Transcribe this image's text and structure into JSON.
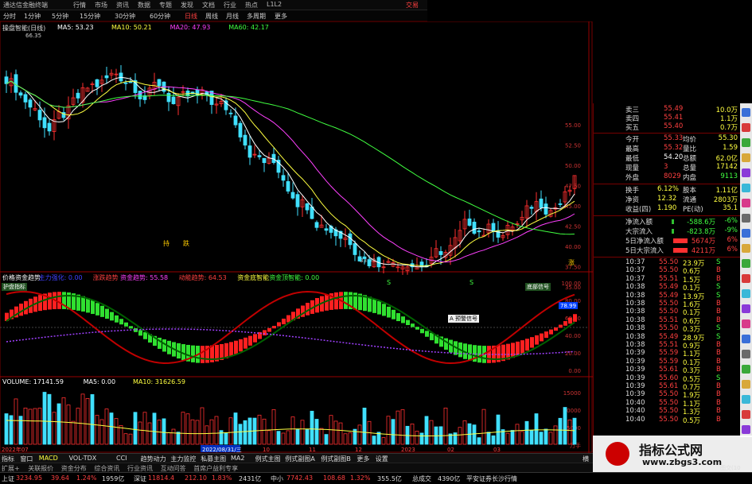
{
  "window": {
    "app_title": "通达信金融终端",
    "menu": [
      "行情",
      "市场",
      "资讯",
      "数据",
      "专题",
      "发现",
      "文档",
      "行业",
      "热点",
      "L1L2"
    ],
    "right_text": "交易"
  },
  "periods": [
    "分时",
    "1分钟",
    "5分钟",
    "15分钟",
    "30分钟",
    "60分钟",
    "日线",
    "周线",
    "月线",
    "多周期",
    "更多"
  ],
  "active_period": "日线",
  "price_panel": {
    "indicator": "操盘智能(日线)",
    "ma_items": [
      {
        "label": "MA5: 53.23",
        "color": "#ffffff"
      },
      {
        "label": "MA10: 50.21",
        "color": "#ffff40"
      },
      {
        "label": "MA20: 47.93",
        "color": "#ff40ff"
      },
      {
        "label": "MA60: 42.17",
        "color": "#40ff40"
      }
    ],
    "high_label": "66.35",
    "low_label": "33.00",
    "axis_labels": [
      "55.00",
      "52.50",
      "50.00",
      "47.50",
      "45.00",
      "42.50",
      "40.00",
      "37.50",
      "35.00"
    ],
    "markers": [
      "持",
      "跌",
      "涨"
    ]
  },
  "flow_panel": {
    "items": [
      {
        "label": "价格资金趋势",
        "color": "#ffffff"
      },
      {
        "label": "主力强化: 0.00",
        "color": "#4040ff"
      },
      {
        "label": "涨跌趋势",
        "color": "#ff4040"
      },
      {
        "label": "资金趋势: 55.58",
        "color": "#ff40ff"
      },
      {
        "label": "动能趋势: 64.53",
        "color": "#ff4040"
      },
      {
        "label": "资金底智能",
        "color": "#ffff40"
      },
      {
        "label": "资金顶智能: 0.00",
        "color": "#40ff40"
      }
    ],
    "axis_labels": [
      "100.00",
      "80.00",
      "60.00",
      "40.00",
      "20.00",
      "0.00"
    ],
    "cur_value": "78.99",
    "s_marks": [
      "S",
      "S"
    ],
    "tooltip": "A 预警信号",
    "tag_left": "护盘指标",
    "tag_right": "底部信号"
  },
  "volume_panel": {
    "items": [
      {
        "label": "VOLUME: 17141.59",
        "color": "#ffffff"
      },
      {
        "label": "MA5: 0.00",
        "color": "#ffffff"
      },
      {
        "label": "MA10: 31626.59",
        "color": "#ffff40"
      }
    ],
    "axis_labels": [
      "15000",
      "10000",
      "5000",
      "万手"
    ],
    "date_left": "2022年07",
    "date_cursor": "2022/08/31/三",
    "month_labels": [
      "10",
      "11",
      "12",
      "2023",
      "02",
      "03"
    ]
  },
  "quote": {
    "rows": [
      {
        "label": "卖三",
        "price": "55.49",
        "vol": "10.0万"
      },
      {
        "label": "卖四",
        "price": "55.41",
        "vol": "1.1万"
      },
      {
        "label": "买五",
        "price": "55.40",
        "vol": "0.7万"
      }
    ],
    "stats": [
      {
        "a": "今开",
        "b": "55.33",
        "c": "均价",
        "d": "55.30"
      },
      {
        "a": "最高",
        "b": "55.32",
        "c": "量比",
        "d": "1.59"
      },
      {
        "a": "最低",
        "b": "54.20",
        "c": "总额",
        "d": "62.0亿"
      },
      {
        "a": "现量",
        "b": "3",
        "c": "总量",
        "d": "17142"
      },
      {
        "a": "外盘",
        "b": "8029",
        "c": "内盘",
        "d": "9113"
      }
    ],
    "stats2": [
      {
        "a": "换手",
        "b": "6.12%",
        "c": "股本",
        "d": "1.11亿"
      },
      {
        "a": "净资",
        "b": "12.32",
        "c": "流通",
        "d": "2803万"
      },
      {
        "a": "收益(四)",
        "b": "1.190",
        "c": "PE(动)",
        "d": "35.1"
      }
    ],
    "flows": [
      {
        "label": "净流入额",
        "val": "-588.6万",
        "pct": "-6%"
      },
      {
        "label": "大宗流入",
        "val": "-823.8万",
        "pct": "-9%"
      },
      {
        "label": "5日净流入额",
        "val": "5674万",
        "pct": "6%"
      },
      {
        "label": "5日大宗流入",
        "val": "4211万",
        "pct": "6%"
      }
    ],
    "trades": [
      {
        "t": "10:37",
        "p": "55.50",
        "v": "23.9万",
        "d": "S"
      },
      {
        "t": "10:37",
        "p": "55.50",
        "v": "0.6万",
        "d": "B"
      },
      {
        "t": "10:37",
        "p": "55.51",
        "v": "1.5万",
        "d": "B"
      },
      {
        "t": "10:38",
        "p": "55.49",
        "v": "0.1万",
        "d": "S"
      },
      {
        "t": "10:38",
        "p": "55.49",
        "v": "13.9万",
        "d": "S"
      },
      {
        "t": "10:38",
        "p": "55.50",
        "v": "1.6万",
        "d": "B"
      },
      {
        "t": "10:38",
        "p": "55.50",
        "v": "0.1万",
        "d": "B"
      },
      {
        "t": "10:38",
        "p": "55.51",
        "v": "0.6万",
        "d": "B"
      },
      {
        "t": "10:38",
        "p": "55.50",
        "v": "0.3万",
        "d": "S"
      },
      {
        "t": "10:38",
        "p": "55.49",
        "v": "28.9万",
        "d": "S"
      },
      {
        "t": "10:38",
        "p": "55.51",
        "v": "0.9万",
        "d": "B"
      },
      {
        "t": "10:39",
        "p": "55.59",
        "v": "1.1万",
        "d": "B"
      },
      {
        "t": "10:39",
        "p": "55.59",
        "v": "0.1万",
        "d": "B"
      },
      {
        "t": "10:39",
        "p": "55.61",
        "v": "0.3万",
        "d": "B"
      },
      {
        "t": "10:39",
        "p": "55.60",
        "v": "0.5万",
        "d": "S"
      },
      {
        "t": "10:39",
        "p": "55.61",
        "v": "0.7万",
        "d": "B"
      },
      {
        "t": "10:39",
        "p": "55.50",
        "v": "1.9万",
        "d": "B"
      },
      {
        "t": "10:40",
        "p": "55.50",
        "v": "1.1万",
        "d": "B"
      },
      {
        "t": "10:40",
        "p": "55.50",
        "v": "1.3万",
        "d": "B"
      },
      {
        "t": "10:40",
        "p": "55.50",
        "v": "0.5万",
        "d": "B"
      }
    ]
  },
  "tabs": [
    "指标",
    "窗口",
    "MACD",
    "VOL-TDX",
    "CCI",
    "趋势动力",
    "主力监控",
    "私募主图",
    "MA2",
    "例式主图",
    "例式副图A",
    "例式副图B",
    "更多",
    "设置"
  ],
  "sub_tabs": [
    "扩展+",
    "关联报价",
    "资金分布",
    "综合资讯",
    "行业资讯",
    "互动问答",
    "首席户益利专享"
  ],
  "status": [
    {
      "text": "上证",
      "color": "#dddddd"
    },
    {
      "text": "3234.95",
      "color": "#ff4040"
    },
    {
      "text": "39.64",
      "color": "#ff4040"
    },
    {
      "text": "1.24%",
      "color": "#ff4040"
    },
    {
      "text": "1959亿",
      "color": "#dddddd"
    },
    {
      "text": "深证",
      "color": "#dddddd"
    },
    {
      "text": "11814.4",
      "color": "#ff4040"
    },
    {
      "text": "212.10",
      "color": "#ff4040"
    },
    {
      "text": "1.83%",
      "color": "#ff4040"
    },
    {
      "text": "2431亿",
      "color": "#dddddd"
    },
    {
      "text": "中小",
      "color": "#dddddd"
    },
    {
      "text": "7742.43",
      "color": "#ff4040"
    },
    {
      "text": "108.68",
      "color": "#ff4040"
    },
    {
      "text": "1.32%",
      "color": "#ff4040"
    },
    {
      "text": "355.5亿",
      "color": "#dddddd"
    },
    {
      "text": "总成交",
      "color": "#dddddd"
    },
    {
      "text": "4390亿",
      "color": "#dddddd"
    },
    {
      "text": "平安证券长沙行情",
      "color": "#dddddd"
    }
  ],
  "watermark": {
    "title": "指标公式网",
    "url": "www.zbgs3.com"
  },
  "side_right_label": "图交(10",
  "bottom_right_label": "横"
}
